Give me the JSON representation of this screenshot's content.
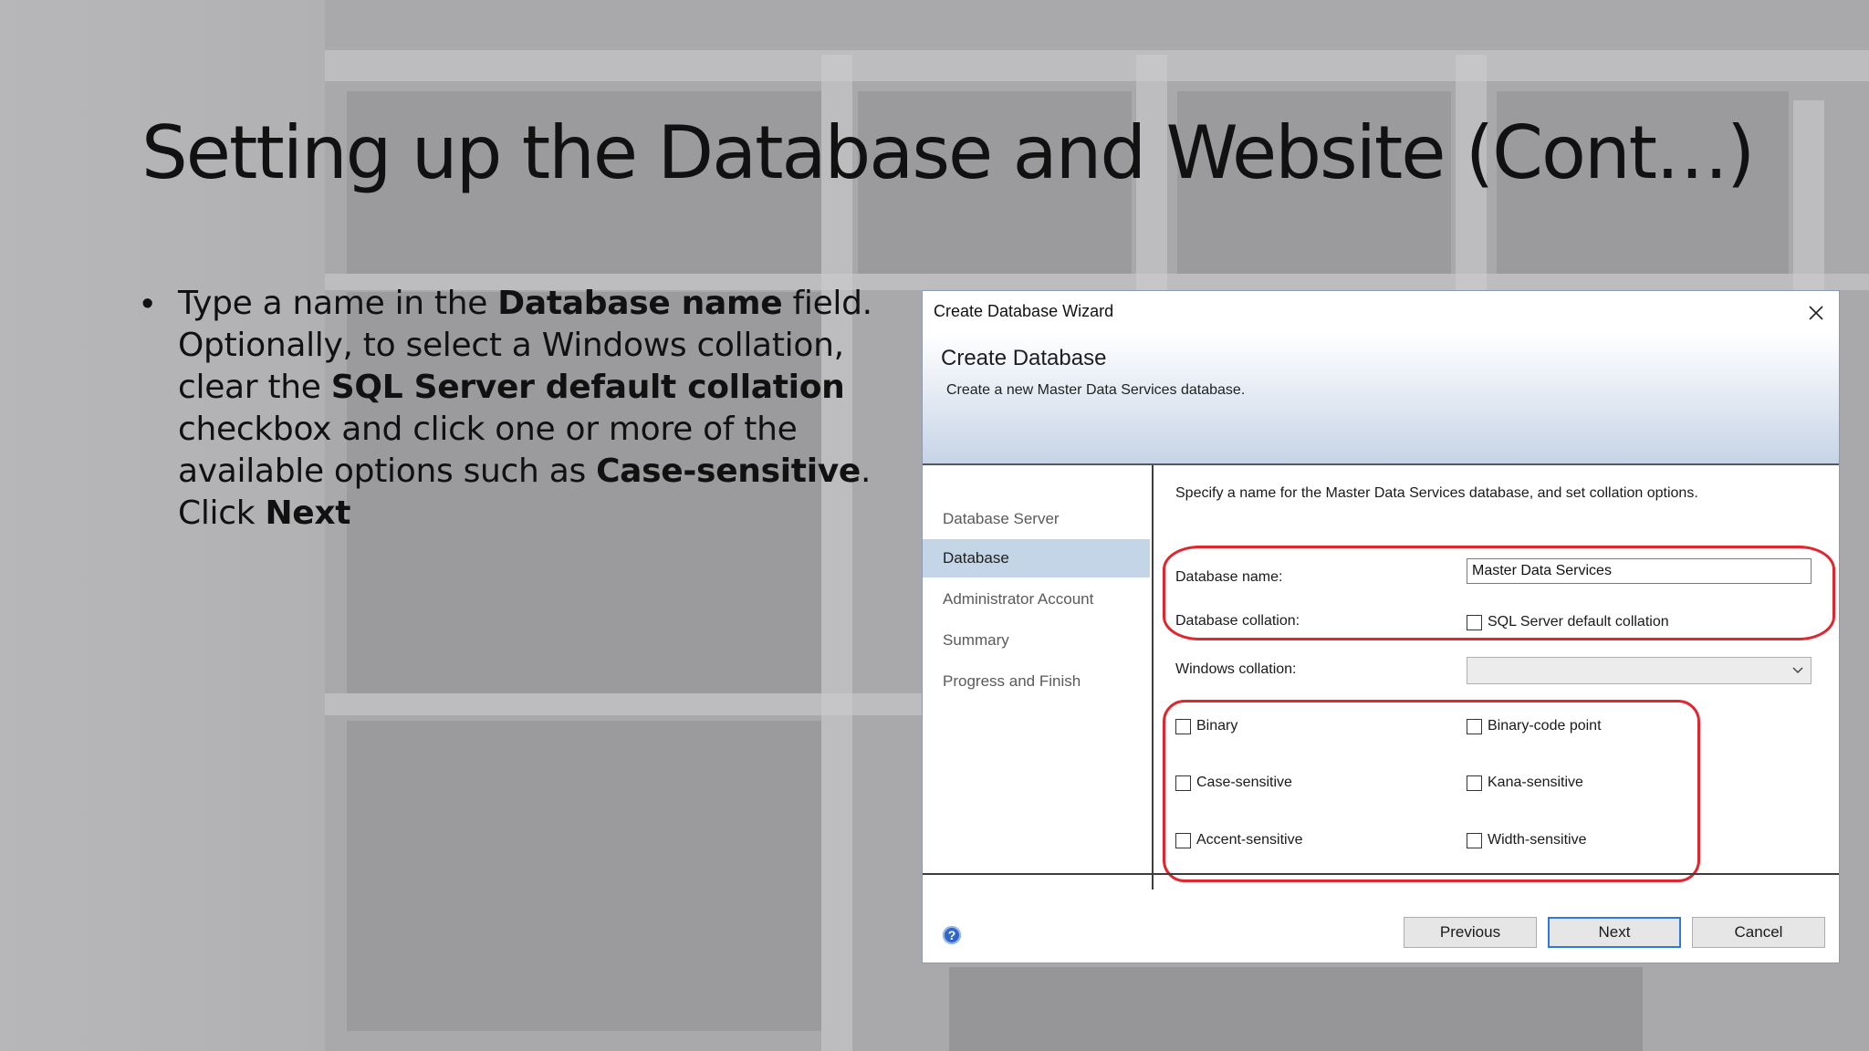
{
  "slide": {
    "title": "Setting up the Database and Website (Cont…)",
    "bullet": {
      "t1": "Type a name in the ",
      "b1": "Database name",
      "t2": " field. Optionally, to select a Windows collation, clear the ",
      "b2": "SQL Server default collation",
      "t3": " checkbox and click one or more of the available options such as ",
      "b3": "Case-sensitive",
      "t4": ". Click ",
      "b4": "Next"
    }
  },
  "dialog": {
    "title": "Create Database Wizard",
    "header": {
      "title": "Create Database",
      "subtitle": "Create a new Master Data Services database."
    },
    "nav": [
      {
        "label": "Database Server",
        "active": false
      },
      {
        "label": "Database",
        "active": true
      },
      {
        "label": "Administrator Account",
        "active": false
      },
      {
        "label": "Summary",
        "active": false
      },
      {
        "label": "Progress and Finish",
        "active": false
      }
    ],
    "content": {
      "intro": "Specify a name for the Master Data Services database, and set collation options.",
      "db_name_label": "Database name:",
      "db_name_value": "Master Data Services",
      "db_collation_label": "Database collation:",
      "sql_default_label": "SQL Server default collation",
      "sql_default_checked": false,
      "windows_collation_label": "Windows collation:",
      "windows_collation_value": "",
      "options": [
        {
          "label": "Binary",
          "checked": false
        },
        {
          "label": "Binary-code point",
          "checked": false
        },
        {
          "label": "Case-sensitive",
          "checked": false
        },
        {
          "label": "Kana-sensitive",
          "checked": false
        },
        {
          "label": "Accent-sensitive",
          "checked": false
        },
        {
          "label": "Width-sensitive",
          "checked": false
        }
      ]
    },
    "buttons": {
      "previous": "Previous",
      "next": "Next",
      "cancel": "Cancel"
    },
    "help_icon": "help-icon",
    "accent_color": "#2a7ae2",
    "highlight_color": "#e0262e"
  }
}
